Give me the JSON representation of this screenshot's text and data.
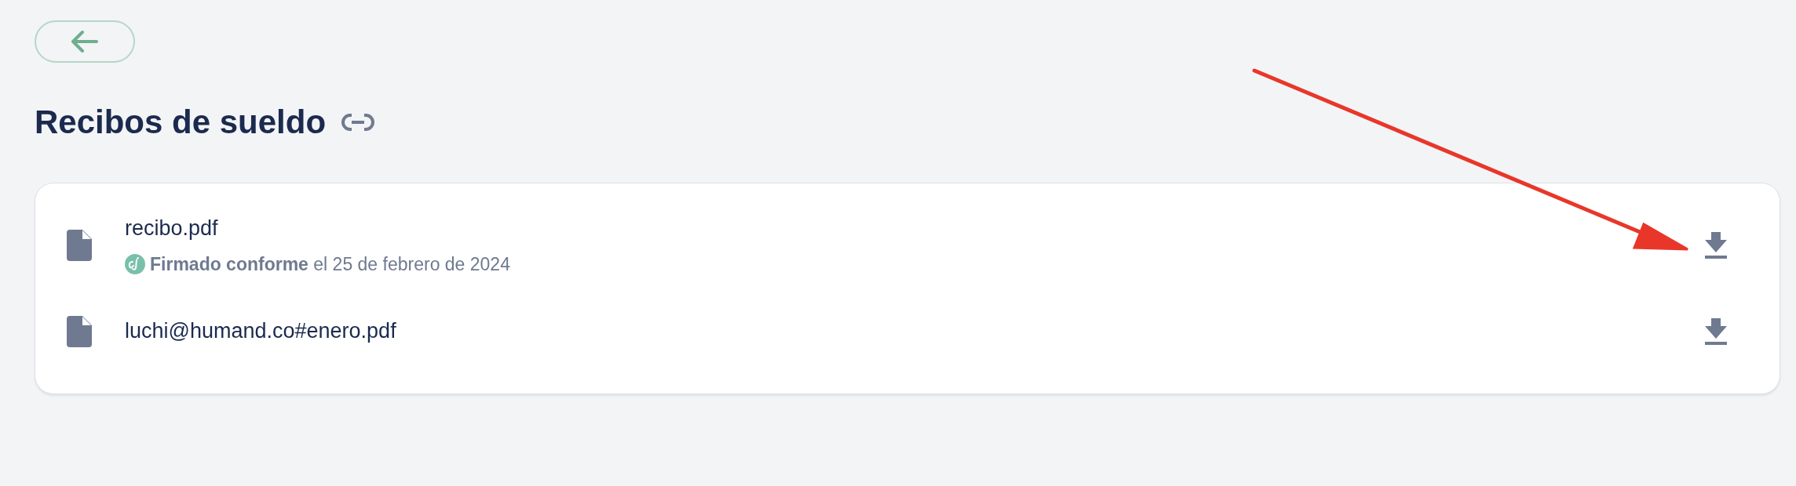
{
  "title": "Recibos de sueldo",
  "files": [
    {
      "name": "recibo.pdf",
      "status": "**Firmado conforme** el 25 de febrero de 2024"
    },
    {
      "name": "luchi@humand.co#enero.pdf"
    }
  ]
}
